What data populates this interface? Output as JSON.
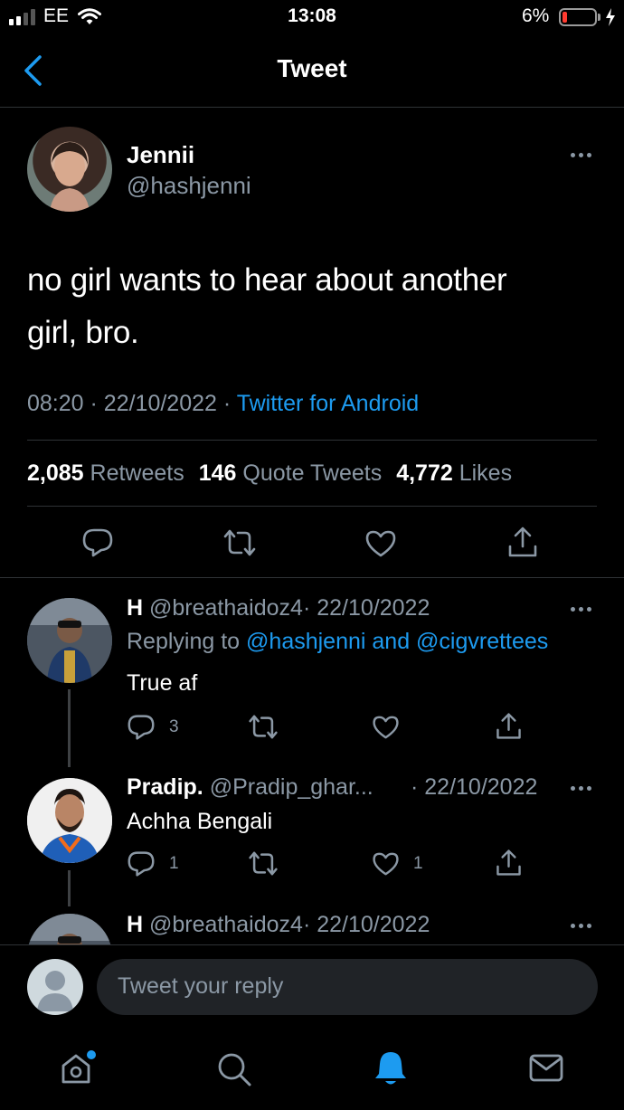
{
  "status_bar": {
    "carrier": "EE",
    "time": "13:08",
    "battery": "6%",
    "battery_level": 0.06,
    "icons": [
      "signal-icon",
      "wifi-icon",
      "battery-icon",
      "charging-icon"
    ]
  },
  "header": {
    "title": "Tweet",
    "back_icon": "chevron-left-icon"
  },
  "tweet": {
    "author_name": "Jennii",
    "author_handle": "@hashjenni",
    "text_line1": "no girl wants to hear about another",
    "text_line2": "girl, bro.",
    "time": "08:20",
    "sep1": "·",
    "date": "22/10/2022",
    "sep2": "·",
    "source": "Twitter for Android",
    "retweets_count": "2,085",
    "retweets_label": "Retweets",
    "quotes_count": "146",
    "quotes_label": "Quote Tweets",
    "likes_count": "4,772",
    "likes_label": "Likes"
  },
  "replies": [
    {
      "name": "H",
      "handle": "@breathaidoz4",
      "date": "· 22/10/2022",
      "replying_prefix": "Replying to",
      "replying_to": "@hashjenni and @cigvrettees",
      "text": "True af",
      "reply_count": "3",
      "retweet_count": "",
      "like_count": ""
    },
    {
      "name": "Pradip.",
      "handle": "@Pradip_ghar...",
      "date": "· 22/10/2022",
      "text": "Achha Bengali",
      "reply_count": "1",
      "retweet_count": "",
      "like_count": "1"
    },
    {
      "name": "H",
      "handle": "@breathaidoz4",
      "date": "· 22/10/2022"
    }
  ],
  "composer": {
    "placeholder": "Tweet your reply"
  },
  "tab_bar": {
    "items": [
      "home-icon",
      "search-icon",
      "notifications-icon",
      "messages-icon"
    ],
    "active": "notifications-icon",
    "accent": "#1d9bf0"
  },
  "colors": {
    "background": "#000000",
    "text": "#ffffff",
    "secondary": "#8b98a5",
    "link": "#1d9bf0",
    "divider": "#2f3336"
  }
}
